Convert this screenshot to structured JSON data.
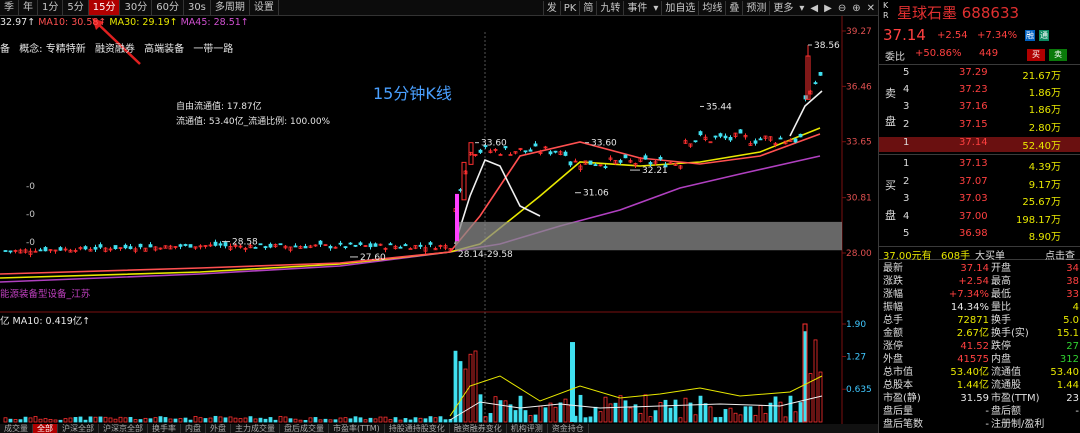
{
  "toolbar": {
    "tabs": [
      "季",
      "年",
      "1分",
      "5分",
      "15分",
      "30分",
      "60分",
      "30s",
      "多周期",
      "设置"
    ],
    "active_tab": "15分",
    "right_buttons": [
      "发",
      "PK",
      "简",
      "九转",
      "事件",
      "加自选",
      "均线",
      "叠",
      "预测",
      "更多"
    ]
  },
  "ma_legend": {
    "prefix": "32.97↑",
    "ma10": "MA10: 30.58↑",
    "ma30": "MA30: 29.19↑",
    "ma45": "MA45: 28.51↑"
  },
  "concept": {
    "items": [
      "备",
      "概念: 专精特新",
      "融资融券",
      "高端装备",
      "一带一路"
    ]
  },
  "info": {
    "float_value": "自由流通值: 17.87亿",
    "circulating": "流通值: 53.40亿_流通比例: 100.00%"
  },
  "annotation": {
    "title": "15分钟K线"
  },
  "price_labels": {
    "p1": "38.56",
    "p2": "35.44",
    "p3": "33.60",
    "p4": "33.60",
    "p5": "32.21",
    "p6": "31.06",
    "p7": "28.58",
    "p8": "27.60",
    "p9": "28.14-29.58"
  },
  "axis": {
    "price_ticks": [
      "39.27",
      "36.46",
      "33.65",
      "30.81",
      "28.00"
    ],
    "vol_ticks": [
      "1.90",
      "1.27",
      "0.635"
    ]
  },
  "left_marks": [
    "-0",
    "-0",
    "-0"
  ],
  "sector": "能源装备型设备_江苏",
  "vol_legend": {
    "prefix": "亿",
    "ma10": "MA10: 0.419亿↑"
  },
  "bottom_tabs": [
    "成交量",
    "全部",
    "沪深全部",
    "沪深京全部",
    "换手率",
    "内盘",
    "外盘",
    "主力成交量",
    "盘后成交量",
    "市盈率(TTM)",
    "持股通持股变化",
    "融资融券变化",
    "机构评测",
    "资金持仓"
  ],
  "bottom_active": "全部",
  "stock": {
    "kr": "K R",
    "name": "星球石墨 688633",
    "price": "37.14",
    "change": "+2.54",
    "pct": "+7.34%",
    "tag1": "融",
    "tag2": "通"
  },
  "webi": {
    "label": "委比",
    "ratio": "+50.86%",
    "diff": "449",
    "buy": "买",
    "sell": "卖"
  },
  "ask": [
    {
      "lv": "5",
      "price": "37.29",
      "vol": "21.67万"
    },
    {
      "lv": "4",
      "price": "37.23",
      "vol": "1.86万"
    },
    {
      "lv": "3",
      "price": "37.16",
      "vol": "1.86万"
    },
    {
      "lv": "2",
      "price": "37.15",
      "vol": "2.80万"
    },
    {
      "lv": "1",
      "price": "37.14",
      "vol": "52.40万"
    }
  ],
  "bid": [
    {
      "lv": "1",
      "price": "37.13",
      "vol": "4.39万"
    },
    {
      "lv": "2",
      "price": "37.07",
      "vol": "9.17万"
    },
    {
      "lv": "3",
      "price": "37.03",
      "vol": "25.67万"
    },
    {
      "lv": "4",
      "price": "37.00",
      "vol": "198.17万"
    },
    {
      "lv": "5",
      "price": "36.98",
      "vol": "8.90万"
    }
  ],
  "side": {
    "sell": [
      "卖",
      "盘"
    ],
    "buy": [
      "买",
      "盘"
    ]
  },
  "summary": {
    "left": "37.00元有",
    "mid": "608手",
    "right": "大买单",
    "far": "点击查"
  },
  "stats": [
    {
      "k1": "最新",
      "v1": "37.14",
      "c1": "red",
      "k2": "开盘",
      "v2": "34",
      "c2": "red"
    },
    {
      "k1": "涨跌",
      "v1": "+2.54",
      "c1": "red",
      "k2": "最高",
      "v2": "38",
      "c2": "red"
    },
    {
      "k1": "涨幅",
      "v1": "+7.34%",
      "c1": "red",
      "k2": "最低",
      "v2": "33",
      "c2": "red"
    },
    {
      "k1": "振幅",
      "v1": "14.34%",
      "c1": "wht",
      "k2": "量比",
      "v2": "4",
      "c2": "yel"
    },
    {
      "k1": "总手",
      "v1": "72871",
      "c1": "yel",
      "k2": "换手",
      "v2": "5.0",
      "c2": "yel"
    },
    {
      "k1": "金额",
      "v1": "2.67亿",
      "c1": "yel",
      "k2": "换手(实)",
      "v2": "15.1",
      "c2": "yel"
    },
    {
      "k1": "涨停",
      "v1": "41.52",
      "c1": "red",
      "k2": "跌停",
      "v2": "27",
      "c2": "green"
    },
    {
      "k1": "外盘",
      "v1": "41575",
      "c1": "red",
      "k2": "内盘",
      "v2": "312",
      "c2": "green"
    },
    {
      "k1": "总市值",
      "v1": "53.40亿",
      "c1": "yel",
      "k2": "流通值",
      "v2": "53.40",
      "c2": "yel"
    },
    {
      "k1": "总股本",
      "v1": "1.44亿",
      "c1": "yel",
      "k2": "流通股",
      "v2": "1.44",
      "c2": "yel"
    },
    {
      "k1": "市盈(静)",
      "v1": "31.59",
      "c1": "wht",
      "k2": "市盈(TTM)",
      "v2": "23",
      "c2": "wht"
    },
    {
      "k1": "盘后量",
      "v1": "-",
      "c1": "wht",
      "k2": "盘后额",
      "v2": "-",
      "c2": "wht"
    },
    {
      "k1": "盘后笔数",
      "v1": "-",
      "c1": "wht",
      "k2": "注册制/盈利",
      "v2": "",
      "c2": "wht"
    }
  ]
}
